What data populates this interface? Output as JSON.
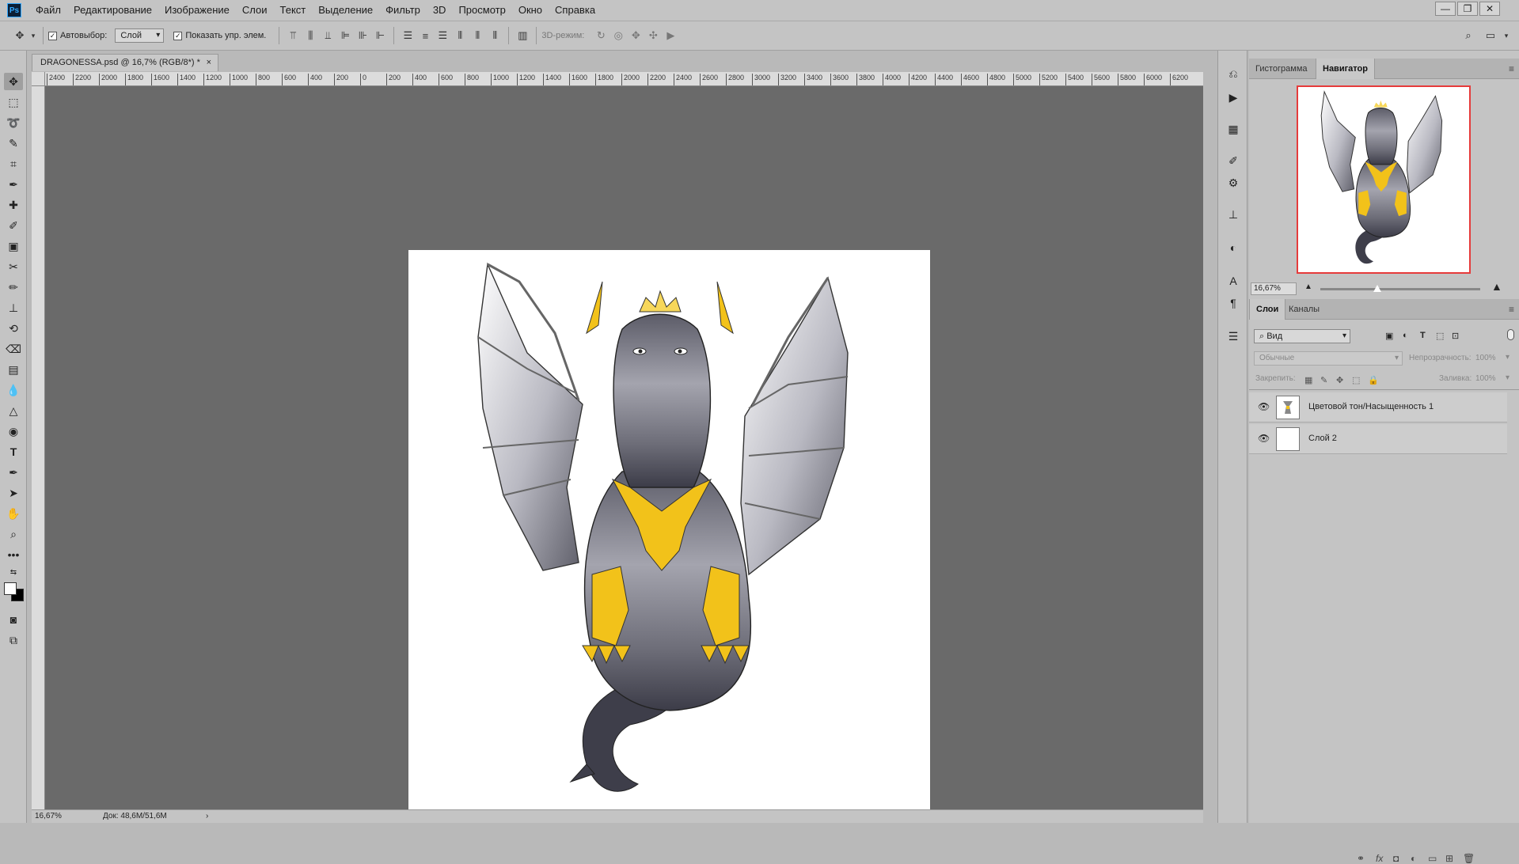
{
  "menu": [
    "Файл",
    "Редактирование",
    "Изображение",
    "Слои",
    "Текст",
    "Выделение",
    "Фильтр",
    "3D",
    "Просмотр",
    "Окно",
    "Справка"
  ],
  "app_logo": "Ps",
  "options": {
    "autoselect_label": "Автовыбор:",
    "autoselect_value": "Слой",
    "show_transform_label": "Показать упр. элем.",
    "mode_3d_label": "3D-режим:"
  },
  "document": {
    "tab_title": "DRAGONESSA.psd @ 16,7% (RGB/8*) *",
    "ruler_ticks": [
      "2400",
      "2200",
      "2000",
      "1800",
      "1600",
      "1400",
      "1200",
      "1000",
      "800",
      "600",
      "400",
      "200",
      "0",
      "200",
      "400",
      "600",
      "800",
      "1000",
      "1200",
      "1400",
      "1600",
      "1800",
      "2000",
      "2200",
      "2400",
      "2600",
      "2800",
      "3000",
      "3200",
      "3400",
      "3600",
      "3800",
      "4000",
      "4200",
      "4400",
      "4600",
      "4800",
      "5000",
      "5200",
      "5400",
      "5600",
      "5800",
      "6000",
      "6200"
    ],
    "zoom": "16,67%",
    "doc_size": "Док: 48,6M/51,6M"
  },
  "navigator": {
    "tab_histogram": "Гистограмма",
    "tab_navigator": "Навигатор",
    "zoom": "16,67%"
  },
  "layers_panel": {
    "tab_layers": "Слои",
    "tab_channels": "Каналы",
    "filter_label": "Вид",
    "blend_mode": "Обычные",
    "opacity_label": "Непрозрачность:",
    "opacity_value": "100%",
    "lock_label": "Закрепить:",
    "fill_label": "Заливка:",
    "fill_value": "100%",
    "layers": [
      {
        "name": "Цветовой тон/Насыщенность 1"
      },
      {
        "name": "Слой 2"
      }
    ]
  },
  "colors": {
    "workspace": "#6a6a6a",
    "nav_frame": "#e63b3b",
    "accent_yellow": "#f2c21a"
  }
}
